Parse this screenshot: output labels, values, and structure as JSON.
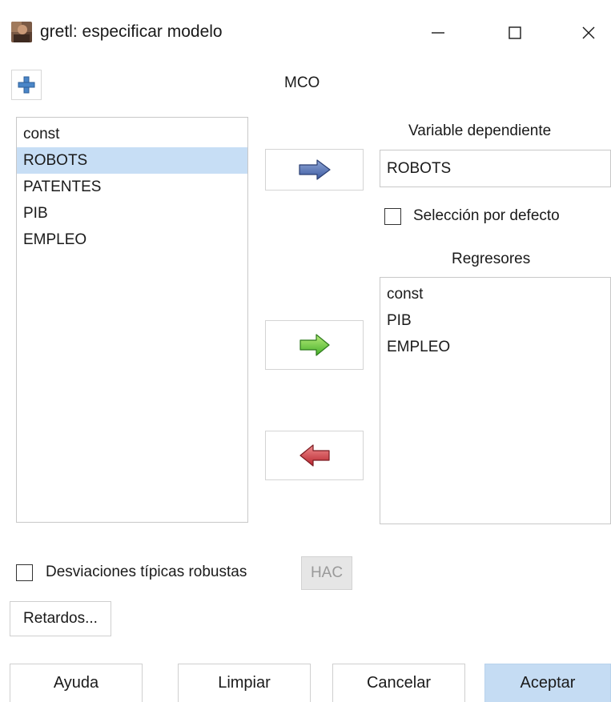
{
  "window": {
    "title": "gretl: especificar modelo",
    "minimize_icon": "minimize-icon",
    "maximize_icon": "maximize-icon",
    "close_icon": "close-icon"
  },
  "toolbar": {
    "add_icon": "plus-icon"
  },
  "model_title": "MCO",
  "variables": [
    "const",
    "ROBOTS",
    "PATENTES",
    "PIB",
    "EMPLEO"
  ],
  "variables_selected_index": 1,
  "arrows": {
    "to_dependent": "arrow-right-blue",
    "add_regressor": "arrow-right-green",
    "remove_regressor": "arrow-left-red"
  },
  "dependent": {
    "label": "Variable dependiente",
    "value": "ROBOTS",
    "default_checkbox_label": "Selección por defecto",
    "default_checked": false
  },
  "regressors": {
    "label": "Regresores",
    "items": [
      "const",
      "PIB",
      "EMPLEO"
    ]
  },
  "options": {
    "robust_label": "Desviaciones típicas robustas",
    "robust_checked": false,
    "hac_label": "HAC",
    "lags_label": "Retardos..."
  },
  "buttons": {
    "help": "Ayuda",
    "clear": "Limpiar",
    "cancel": "Cancelar",
    "ok": "Aceptar"
  },
  "colors": {
    "selection": "#c7def5",
    "primary_button": "#c5dcf3",
    "arrow_blue": "#4a6fb5",
    "arrow_green": "#5cc23a",
    "arrow_red": "#c9303a"
  }
}
